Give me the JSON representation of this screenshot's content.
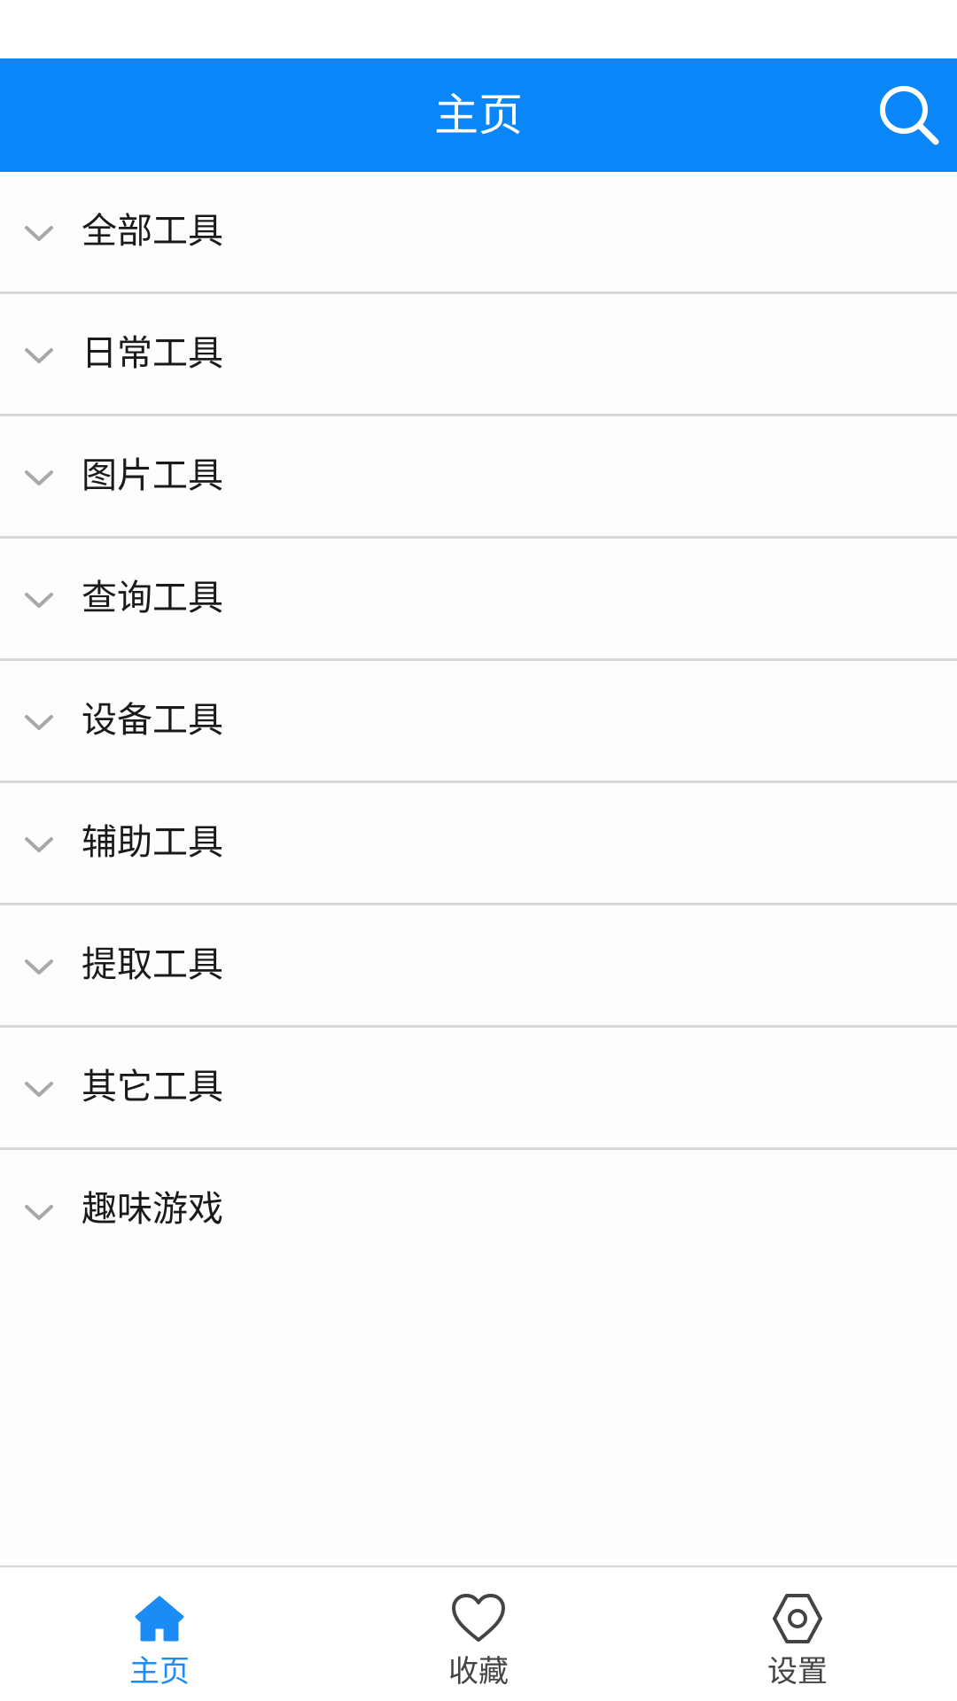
{
  "header": {
    "title": "主页",
    "search_icon": "search-icon"
  },
  "categories": [
    {
      "label": "全部工具",
      "icon": "chevron-down-icon"
    },
    {
      "label": "日常工具",
      "icon": "chevron-down-icon"
    },
    {
      "label": "图片工具",
      "icon": "chevron-down-icon"
    },
    {
      "label": "查询工具",
      "icon": "chevron-down-icon"
    },
    {
      "label": "设备工具",
      "icon": "chevron-down-icon"
    },
    {
      "label": "辅助工具",
      "icon": "chevron-down-icon"
    },
    {
      "label": "提取工具",
      "icon": "chevron-down-icon"
    },
    {
      "label": "其它工具",
      "icon": "chevron-down-icon"
    },
    {
      "label": "趣味游戏",
      "icon": "chevron-down-icon"
    }
  ],
  "bottom_nav": {
    "items": [
      {
        "label": "主页",
        "icon": "home-icon",
        "active": true
      },
      {
        "label": "收藏",
        "icon": "heart-icon",
        "active": false
      },
      {
        "label": "设置",
        "icon": "settings-icon",
        "active": false
      }
    ]
  },
  "colors": {
    "primary": "#0b86f8",
    "active_nav": "#1a8cf3",
    "inactive_nav": "#444444",
    "divider": "#d8d8d8"
  }
}
